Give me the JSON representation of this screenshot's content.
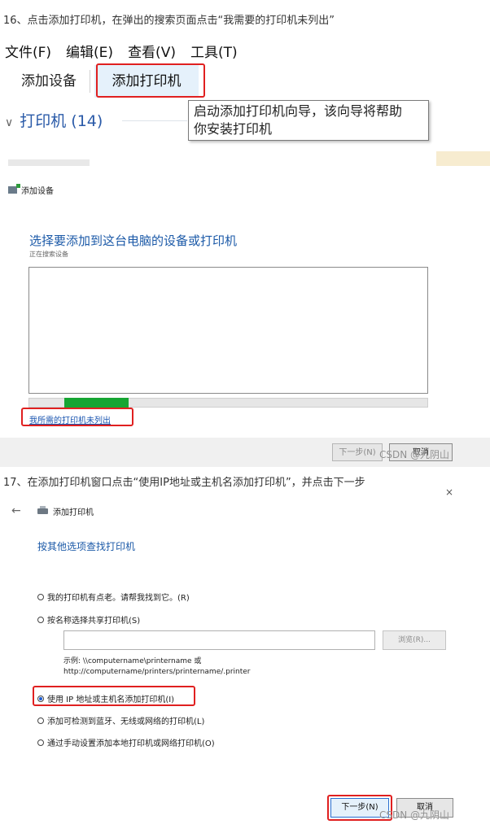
{
  "step16": {
    "text": "16、点击添加打印机，在弹出的搜索页面点击“我需要的打印机未列出”"
  },
  "explorer": {
    "menu": [
      "文件(F)",
      "编辑(E)",
      "查看(V)",
      "工具(T)"
    ],
    "tabs": [
      "添加设备",
      "添加打印机"
    ],
    "group_label": "打印机 (14)",
    "tooltip_line1": "启动添加打印机向导，该向导将帮助",
    "tooltip_line2": "你安装打印机"
  },
  "add_device": {
    "title": "添加设备",
    "heading": "选择要添加到这台电脑的设备或打印机",
    "status": "正在搜索设备",
    "progress": 0.16,
    "not_listed_link": "我所需的打印机未列出",
    "next": "下一步(N)",
    "cancel": "取消"
  },
  "step17": {
    "text": "17、在添加打印机窗口点击“使用IP地址或主机名添加打印机”，并点击下一步"
  },
  "add_printer": {
    "close": "×",
    "back": "←",
    "title": "添加打印机",
    "heading": "按其他选项查找打印机",
    "options": [
      "我的打印机有点老。请帮我找到它。(R)",
      "按名称选择共享打印机(S)",
      "使用 IP 地址或主机名添加打印机(I)",
      "添加可检测到蓝牙、无线或网络的打印机(L)",
      "通过手动设置添加本地打印机或网络打印机(O)"
    ],
    "selected_option": 2,
    "shared_input_value": "",
    "browse": "浏览(R)...",
    "example_line1": "示例: \\\\computername\\printername 或",
    "example_line2": "http://computername/printers/printername/.printer",
    "next": "下一步(N)",
    "cancel": "取消"
  },
  "watermark": "CSDN @九阴山",
  "colors": {
    "highlight": "#e02020",
    "link": "#1c5aa8",
    "progress": "#16a533"
  }
}
